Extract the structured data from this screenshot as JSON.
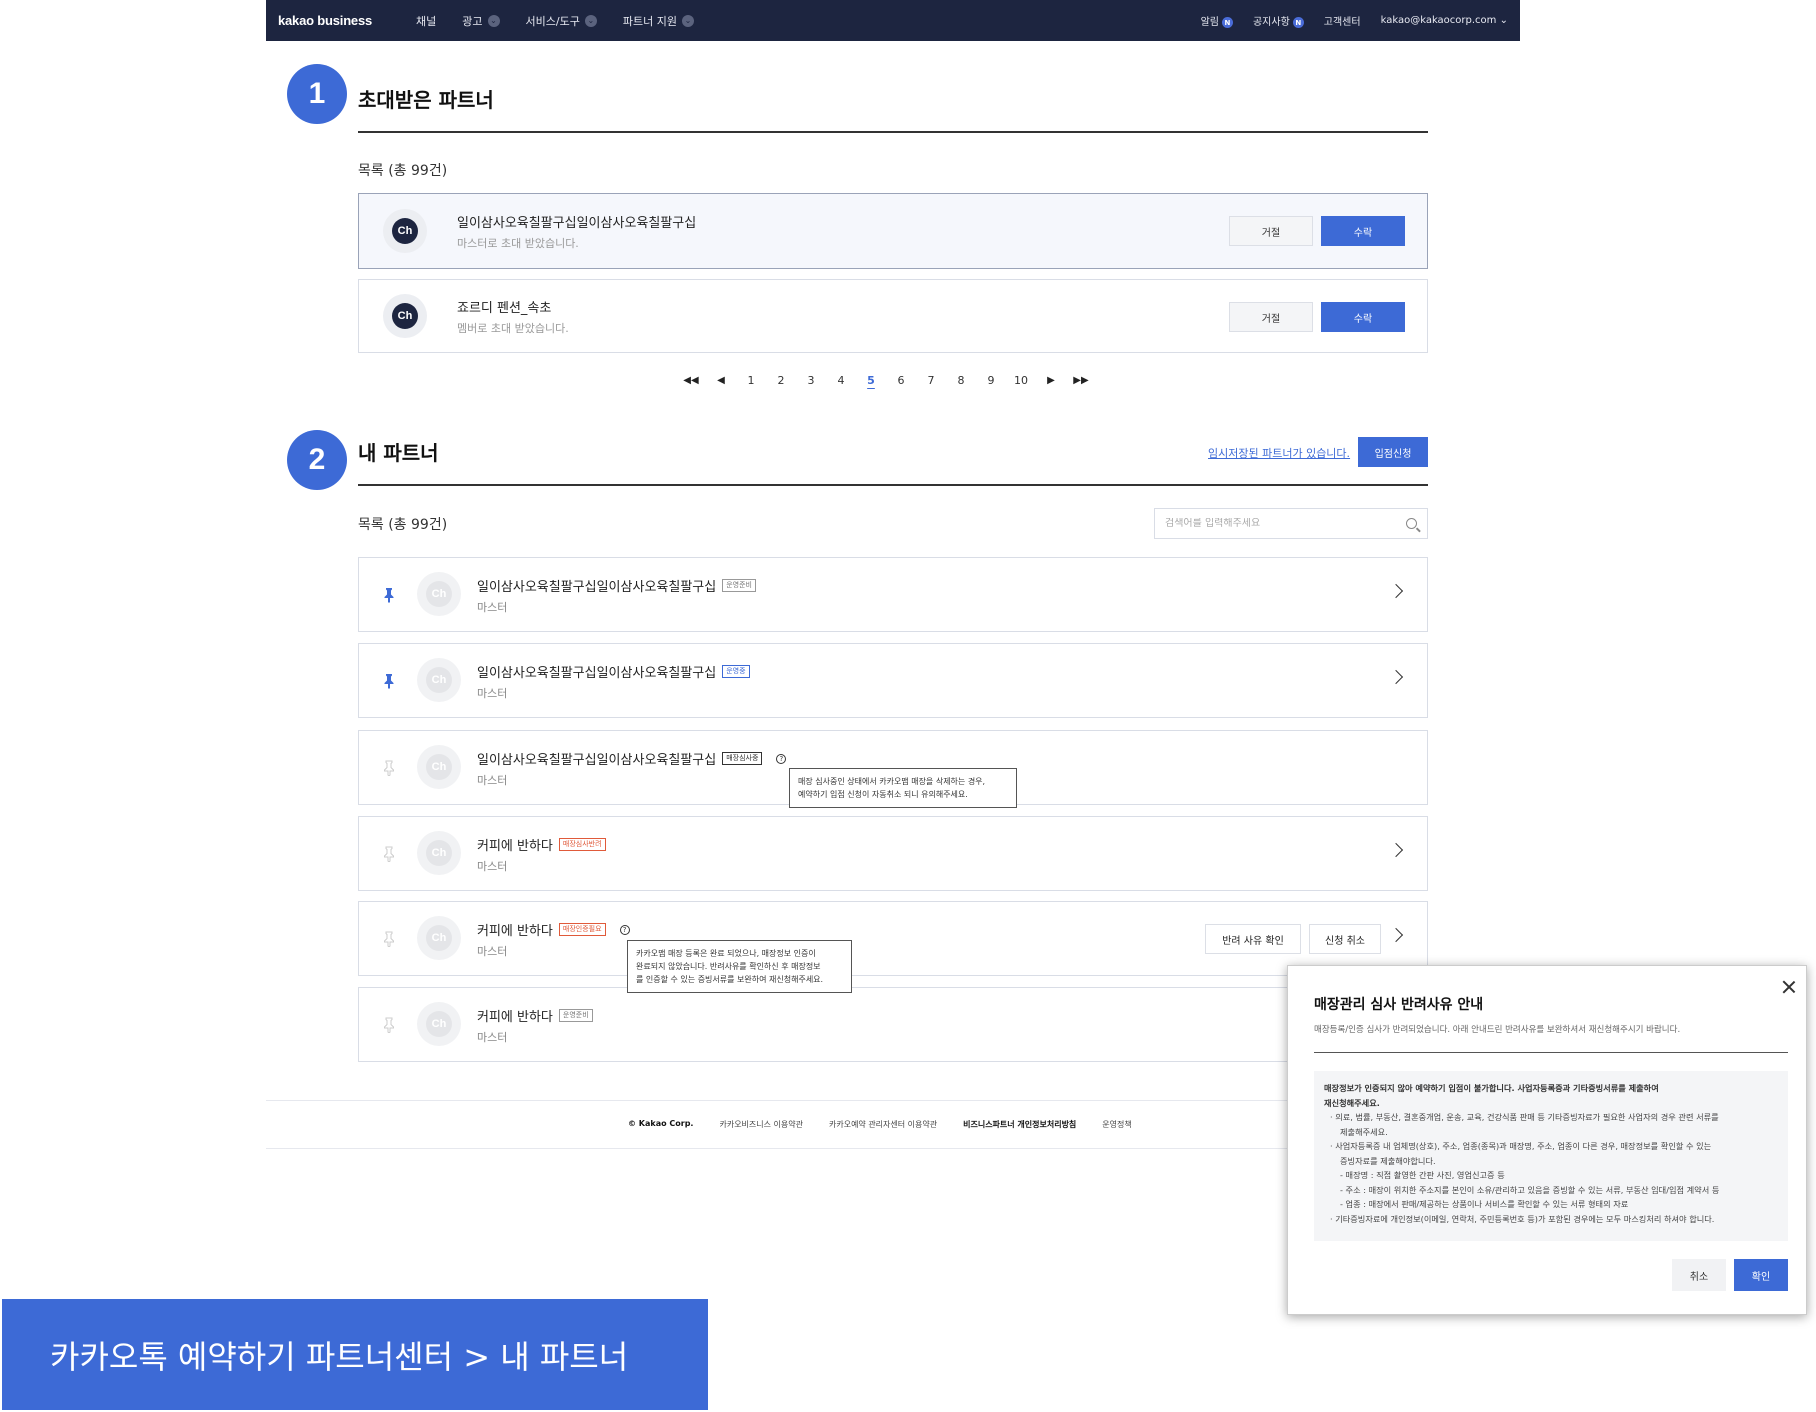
{
  "topnav": {
    "logo": "kakao business",
    "items": [
      {
        "label": "채널",
        "has_dropdown": false
      },
      {
        "label": "광고",
        "has_dropdown": true
      },
      {
        "label": "서비스/도구",
        "has_dropdown": true
      },
      {
        "label": "파트너 지원",
        "has_dropdown": true
      }
    ],
    "right": {
      "alerts": "알림",
      "alerts_badge": "N",
      "notices": "공지사항",
      "notices_badge": "N",
      "support": "고객센터",
      "account": "kakao@kakaocorp.com"
    }
  },
  "section1": {
    "step": "1",
    "title": "초대받은 파트너",
    "count": "목록 (총 99건)",
    "invites": [
      {
        "name": "일이삼사오육칠팔구십일이삼사오육칠팔구십",
        "sub": "마스터로 초대 받았습니다.",
        "reject": "거절",
        "accept": "수락"
      },
      {
        "name": "죠르디 펜션_속초",
        "sub": "멤버로 초대 받았습니다.",
        "reject": "거절",
        "accept": "수락"
      }
    ],
    "pagination": {
      "first": "◀◀",
      "prev": "◀",
      "pages": [
        "1",
        "2",
        "3",
        "4",
        "5",
        "6",
        "7",
        "8",
        "9",
        "10"
      ],
      "current": "5",
      "next": "▶",
      "last": "▶▶"
    }
  },
  "section2": {
    "step": "2",
    "title": "내 파트너",
    "temp_link": "임시저장된 파트너가 있습니다.",
    "apply": "입점신청",
    "count": "목록 (총 99건)",
    "search_placeholder": "검색어를 입력해주세요",
    "partners": [
      {
        "name": "일이삼사오육칠팔구십일이삼사오육칠팔구십",
        "tag": "운영준비",
        "role": "마스터",
        "pinned": true
      },
      {
        "name": "일이삼사오육칠팔구십일이삼사오육칠팔구십",
        "tag": "운영중",
        "role": "마스터",
        "pinned": true
      },
      {
        "name": "일이삼사오육칠팔구십일이삼사오육칠팔구십",
        "tag": "매장심사중",
        "role": "마스터",
        "pinned": false
      },
      {
        "name": "커피에 반하다",
        "tag": "매장심사반려",
        "role": "마스터",
        "pinned": false
      },
      {
        "name": "커피에 반하다",
        "tag": "매장인증필요",
        "role": "마스터",
        "pinned": false,
        "reject_reason": "반려 사유 확인",
        "cancel_apply": "신청 취소"
      },
      {
        "name": "커피에 반하다",
        "tag": "운영준비",
        "role": "마스터",
        "pinned": false
      }
    ],
    "tooltip1": [
      "매장 심사중인 상태에서 카카오맵 매장을 삭제하는 경우,",
      "예약하기 입점 신청이 자동취소 되니 유의해주세요."
    ],
    "tooltip2": [
      "카카오맵 매장 등록은 완료 되었으나, 매장정보 인증이",
      "완료되지 않았습니다. 반려사유를 확인하신 후 매장정보",
      "를 인증할 수 있는 증빙서류를 보완하여 재신청해주세요."
    ]
  },
  "footer": {
    "copyright": "© Kakao Corp.",
    "links": [
      "카카오비즈니스 이용약관",
      "카카오예약 관리자센터 이용약관",
      "비즈니스파트너 개인정보처리방침",
      "운영정책"
    ]
  },
  "modal": {
    "title": "매장관리 심사 반려사유 안내",
    "desc": "매장등록/인증 심사가 반려되었습니다. 아래 안내드린 반려사유를 보완하셔서 재신청해주시기 바랍니다.",
    "headline": [
      "매장정보가 인증되지 않아 예약하기 입점이 불가합니다. 사업자등록증과 기타증빙서류를 제출하여",
      "재신청해주세요."
    ],
    "bullets": [
      "· 의료, 법률, 부동산, 결혼중개업, 운송, 교육, 건강식품 판매 등 기타증빙자료가 필요한 사업자의 경우 관련 서류를",
      "  제출해주세요.",
      "· 사업자등록증 내 업체명(상호), 주소, 업종(종목)과 매장명, 주소, 업종이 다른 경우, 매장정보를 확인할 수 있는",
      "  증빙자료를 제출해야합니다.",
      "- 매장명 : 직접 촬영한 간판 사진, 영업신고증 등",
      "- 주소 : 매장이 위치한 주소지를 본인이 소유/관리하고 있음을 증빙할 수 있는 서류, 부동산 임대/입점 계약서 등",
      "- 업종 : 매장에서 판매/제공하는 상품이나 서비스를 확인할 수 있는 서류 형태의 자료",
      "· 기타증빙자료에 개인정보(이메일, 연락처, 주민등록번호 등)가 포함된 경우에는 모두 마스킹처리 하셔야 합니다."
    ],
    "cancel": "취소",
    "confirm": "확인"
  },
  "caption": "카카오톡 예약하기 파트너센터 > 내 파트너"
}
